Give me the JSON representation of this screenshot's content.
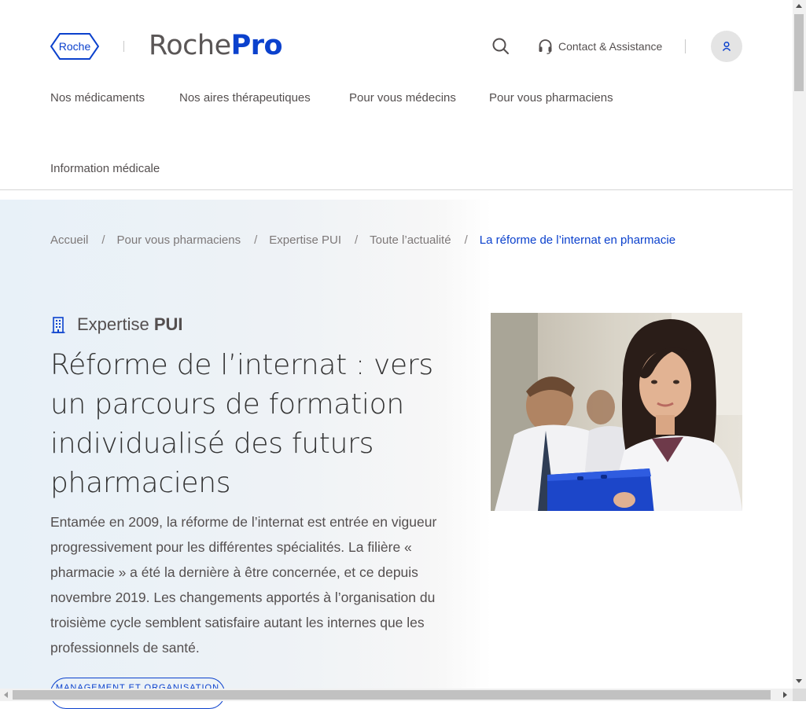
{
  "header": {
    "logo_text": "Roche",
    "brand_part1": "Roche",
    "brand_part2": "Pro",
    "contact_label": "Contact & Assistance",
    "icons": {
      "search": "search-icon",
      "contact": "headset-icon",
      "account": "user-icon"
    }
  },
  "nav": {
    "items": [
      {
        "label": "Nos médicaments"
      },
      {
        "label": "Nos aires thérapeutiques"
      },
      {
        "label": "Pour vous médecins"
      },
      {
        "label": "Pour vous pharmaciens"
      },
      {
        "label": "Information médicale"
      }
    ]
  },
  "breadcrumb": {
    "separator": "/",
    "items": [
      {
        "label": "Accueil"
      },
      {
        "label": "Pour vous pharmaciens"
      },
      {
        "label": "Expertise PUI"
      },
      {
        "label": "Toute l’actualité"
      },
      {
        "label": "La réforme de l’internat en pharmacie"
      }
    ]
  },
  "article": {
    "kicker_part1": "Expertise",
    "kicker_part2": "PUI",
    "title": "Réforme de l’internat : vers un parcours de formation individualisé des futurs pharmaciens",
    "lead": "Entamée en 2009, la réforme de l’internat est entrée en vigueur progressivement pour les différentes spécialités. La filière « pharmacie » a été la dernière à être concernée, et ce depuis novembre 2019. Les changements apportés à l’organisation du troisième cycle semblent satisfaire autant les internes que les professionnels de santé.",
    "tag_label": "MANAGEMENT ET ORGANISATION"
  },
  "colors": {
    "brand_blue": "#0b41cd",
    "text": "#544f4f"
  }
}
